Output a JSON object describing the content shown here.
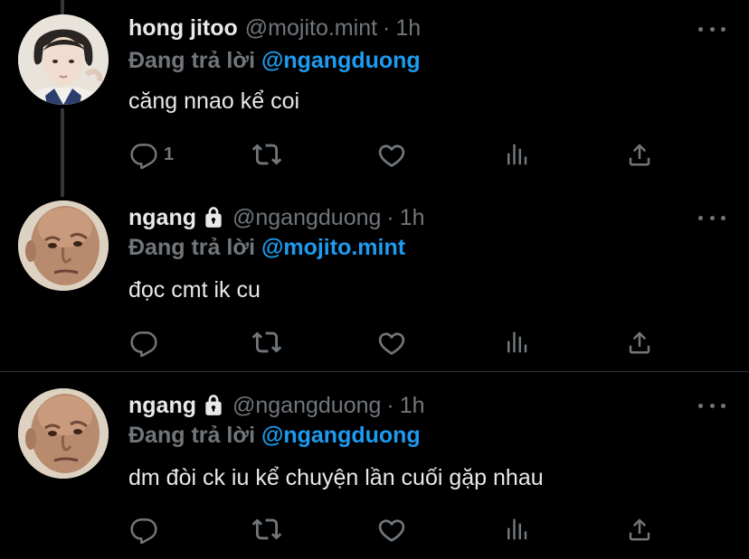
{
  "colors": {
    "background": "#000000",
    "text": "#e7e9ea",
    "muted": "#71767b",
    "accent": "#1d9bf0",
    "divider": "#2f3336"
  },
  "tweets": [
    {
      "display_name": "hong jitoo",
      "protected": false,
      "handle": "@mojito.mint",
      "separator": "·",
      "time": "1h",
      "reply_prefix": "Đang trả lời",
      "reply_to": "@ngangduong",
      "text": "căng nnao kể coi",
      "reply_count": "1",
      "avatar": "young-man-portrait"
    },
    {
      "display_name": "ngang",
      "protected": true,
      "handle": "@ngangduong",
      "separator": "·",
      "time": "1h",
      "reply_prefix": "Đang trả lời",
      "reply_to": "@mojito.mint",
      "text": "đọc cmt ik cu",
      "reply_count": "",
      "avatar": "bald-man-face"
    },
    {
      "display_name": "ngang",
      "protected": true,
      "handle": "@ngangduong",
      "separator": "·",
      "time": "1h",
      "reply_prefix": "Đang trả lời",
      "reply_to": "@ngangduong",
      "text": "dm đòi ck iu kể chuyện lần cuối gặp nhau",
      "reply_count": "",
      "avatar": "bald-man-face"
    }
  ],
  "icons": [
    "reply-icon",
    "retweet-icon",
    "like-icon",
    "analytics-icon",
    "share-icon",
    "more-icon",
    "lock-icon"
  ]
}
